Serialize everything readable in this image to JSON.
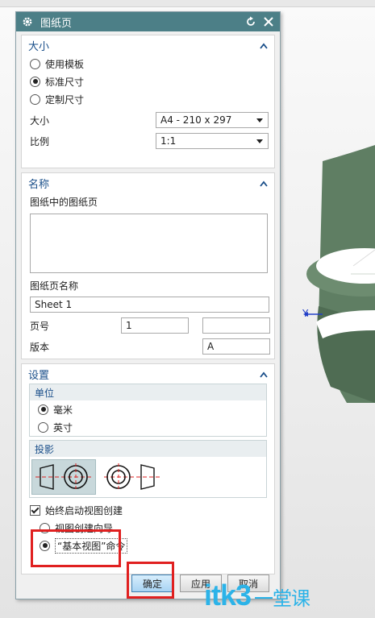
{
  "dialog": {
    "title": "图纸页"
  },
  "size_section": {
    "header": "大小",
    "options": [
      "使用模板",
      "标准尺寸",
      "定制尺寸"
    ],
    "selected_option": "标准尺寸",
    "size_label": "大小",
    "size_value": "A4 - 210 x 297",
    "scale_label": "比例",
    "scale_value": "1:1"
  },
  "name_section": {
    "header": "名称",
    "sheets_in_drawing_label": "图纸中的图纸页",
    "sheet_name_label": "图纸页名称",
    "sheet_name_value": "Sheet 1",
    "page_number_label": "页号",
    "page_number_value": "1",
    "page_number_extra_value": "",
    "revision_label": "版本",
    "revision_value": "A"
  },
  "settings_section": {
    "header": "设置",
    "units_label": "单位",
    "unit_options": [
      "毫米",
      "英寸"
    ],
    "selected_unit": "毫米",
    "projection_label": "投影",
    "selected_projection": "first-angle",
    "always_start_view_creation_label": "始终启动视图创建",
    "always_start_view_creation_checked": true,
    "view_creation_options": [
      "视图创建向导",
      "“基本视图”命令"
    ],
    "selected_view_creation": "“基本视图”命令"
  },
  "footer": {
    "ok_label": "确定",
    "apply_label": "应用",
    "cancel_label": "取消"
  },
  "viewport": {
    "axis_label": "Y"
  },
  "watermark": {
    "text": "itk3",
    "suffix": "一堂课"
  },
  "colors": {
    "titlebar": "#4c7f87",
    "section_header": "#1a4f8a",
    "highlight": "#e02020",
    "model_green": "#5f7e63"
  }
}
